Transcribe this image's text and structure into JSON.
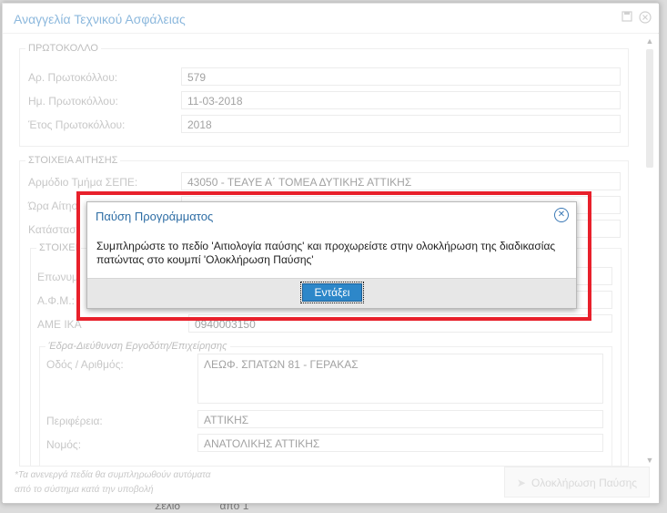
{
  "modal": {
    "title": "Αναγγελία Τεχνικού Ασφάλειας"
  },
  "protocol": {
    "legend": "ΠΡΩΤΟΚΟΛΛΟ",
    "number_label": "Αρ. Πρωτοκόλλου:",
    "number_value": "579",
    "date_label": "Ημ. Πρωτοκόλλου:",
    "date_value": "11-03-2018",
    "year_label": "Έτος Πρωτοκόλλου:",
    "year_value": "2018"
  },
  "application": {
    "legend": "ΣΤΟΙΧΕΙΑ ΑΙΤΗΣΗΣ",
    "dept_label": "Αρμόδιο Τμήμα ΣΕΠΕ:",
    "dept_value": "43050 - ΤΕΑΥΕ Α΄ ΤΟΜΕΑ ΔΥΤΙΚΗΣ ΑΤΤΙΚΗΣ",
    "hour_label": "Ώρα Αίτησ",
    "status_label": "Κατάστασ",
    "employer_legend": "ΣΤΟΙΧΕΙ",
    "name_label": "Επωνυμ",
    "afm_label": "Α.Φ.Μ.:",
    "ame_label": "ΑΜΕ ΙΚΑ",
    "ame_value": "0940003150"
  },
  "address": {
    "legend": "Έδρα-Διεύθυνση Εργοδότη/Επιχείρησης",
    "street_label": "Οδός / Αριθμός:",
    "street_value": "ΛΕΩΦ. ΣΠΑΤΩΝ 81 - ΓΕΡΑΚΑΣ",
    "region_label": "Περιφέρεια:",
    "region_value": "ΑΤΤΙΚΗΣ",
    "prefecture_label": "Νομός:",
    "prefecture_value": "ΑΝΑΤΟΛΙΚΗΣ ΑΤΤΙΚΗΣ"
  },
  "footer": {
    "note_line1": "*Τα ανενεργά πεδία θα συμπληρωθούν αυτόματα",
    "note_line2": "από το σύστημα κατά την υποβολή",
    "pause_button": "Ολοκλήρωση Παύσης"
  },
  "dialog": {
    "title": "Παύση Προγράμματος",
    "message_line1": "Συμπληρώστε το πεδίο 'Αιτιολογία παύσης' και προχωρείστε στην ολοκλήρωση της διαδικασίας",
    "message_line2": "πατώντας στο κουμπί 'Ολοκλήρωση Παύσης'",
    "ok_button": "Εντάξει"
  },
  "background": {
    "bottom_left": "Σελίδ",
    "bottom_mid": "από 1"
  },
  "colors": {
    "accent": "#2f7fc1",
    "highlight_frame": "#e8202b",
    "ok_button": "#2d87c9"
  }
}
